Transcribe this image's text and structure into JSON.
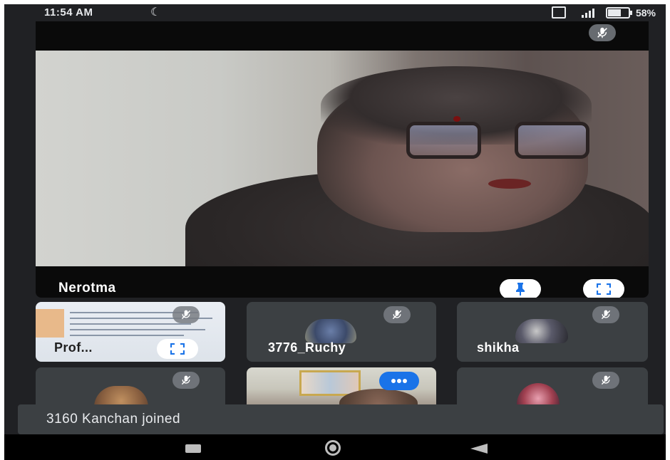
{
  "status_bar": {
    "time": "11:54 AM",
    "battery": "58",
    "network": "4G"
  },
  "main_speaker": {
    "name": "Nerotma"
  },
  "participants": [
    {
      "name": "Prof...",
      "type": "screen-share"
    },
    {
      "name": "3776_Ruchy",
      "type": "avatar"
    },
    {
      "name": "shikha",
      "type": "avatar"
    },
    {
      "name": "",
      "type": "avatar"
    },
    {
      "name": "",
      "type": "camera"
    },
    {
      "name": "",
      "type": "avatar"
    }
  ],
  "toast": {
    "message": "3160 Kanchan joined"
  },
  "icons": {
    "mic_off": "mic-off-icon",
    "pin": "pin-icon",
    "fullscreen": "fullscreen-icon",
    "more": "more-options-icon"
  },
  "colors": {
    "background": "#202124",
    "tile": "#3c4043",
    "accent": "#1a73e8"
  }
}
